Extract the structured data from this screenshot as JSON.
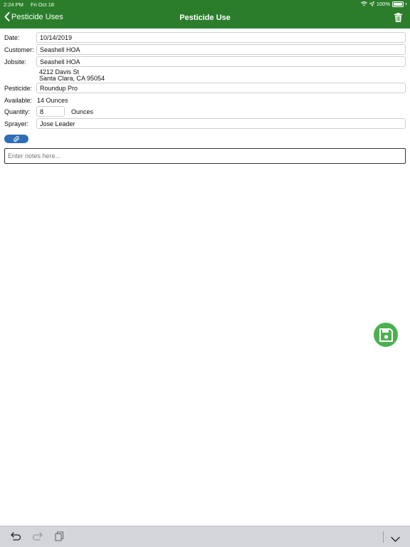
{
  "status_bar": {
    "time": "2:24 PM",
    "date": "Fri Oct 18",
    "battery": "100%"
  },
  "nav": {
    "back_label": "Pesticide Uses",
    "title": "Pesticide Use"
  },
  "form": {
    "date_label": "Date:",
    "date_value": "10/14/2019",
    "customer_label": "Customer:",
    "customer_value": "Seashell  HOA",
    "jobsite_label": "Jobsite:",
    "jobsite_value": "Seashell HOA",
    "address_line1": "4212 Davis St",
    "address_line2": "Santa Clara, CA  95054",
    "pesticide_label": "Pesticide:",
    "pesticide_value": "Roundup Pro",
    "available_label": "Available:",
    "available_value": "14 Ounces",
    "quantity_label": "Quantity:",
    "quantity_value": "8",
    "quantity_unit": "Ounces",
    "sprayer_label": "Sprayer:",
    "sprayer_value": "Jose Leader"
  },
  "notes": {
    "placeholder": "Enter notes here..."
  },
  "colors": {
    "header_green": "#2b7d2b",
    "save_green": "#4cb050",
    "attach_blue": "#2e6fb6"
  },
  "icons": {
    "back": "chevron-left-icon",
    "trash": "trash-icon",
    "attach": "paperclip-icon",
    "save": "floppy-disk-icon",
    "undo": "undo-icon",
    "redo": "redo-icon",
    "paste": "clipboard-icon",
    "dismiss": "chevron-down-icon"
  }
}
